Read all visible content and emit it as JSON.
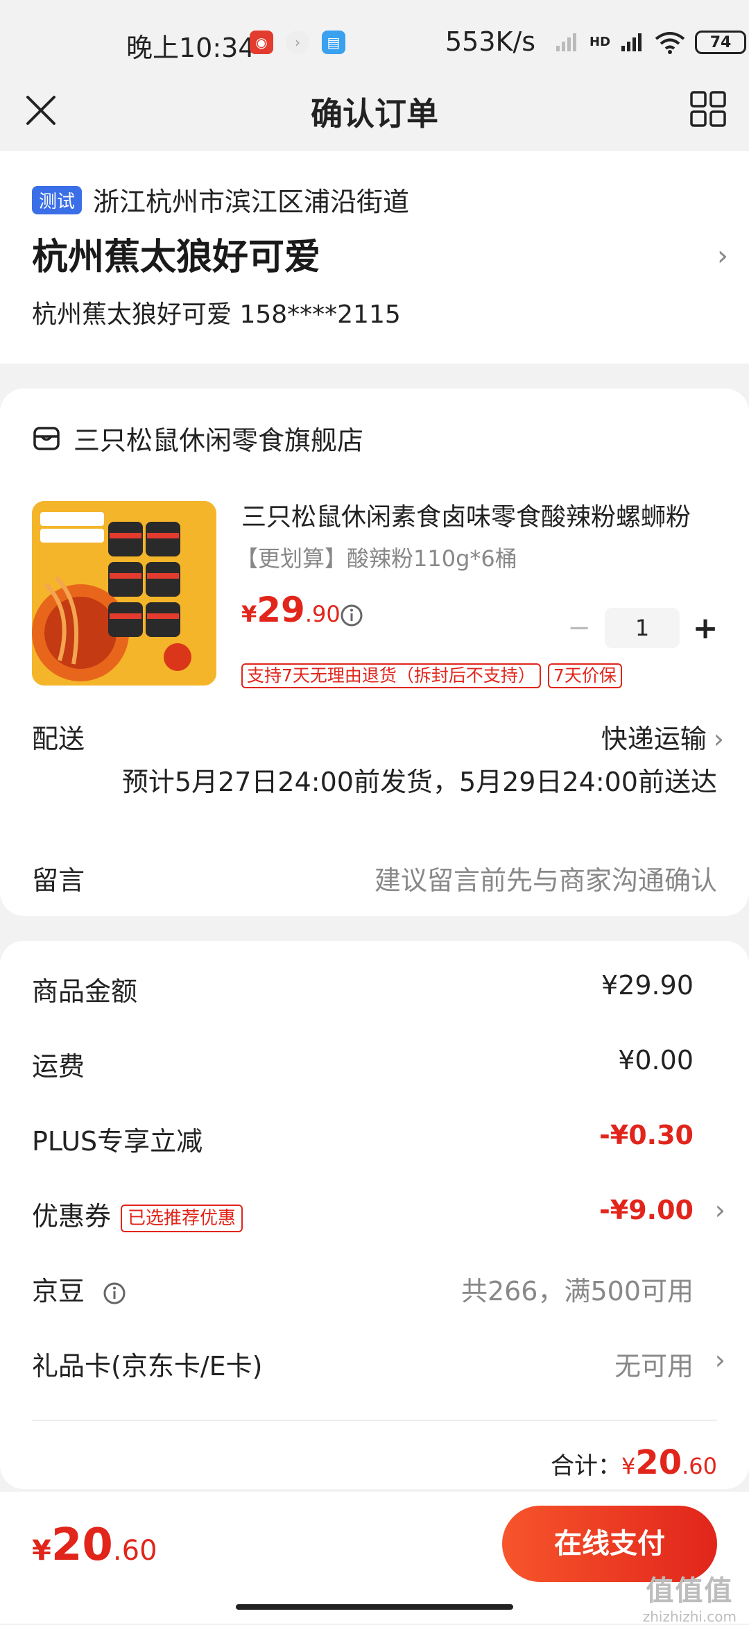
{
  "status_bar": {
    "time": "晚上10:34",
    "net_speed": "553K/s",
    "hd_label": "HD",
    "battery": "74"
  },
  "nav": {
    "title": "确认订单"
  },
  "address": {
    "tag": "测试",
    "region": "浙江杭州市滨江区浦沿街道",
    "title": "杭州蕉太狼好可爱",
    "person": "杭州蕉太狼好可爱  158****2115",
    "chevron": "›"
  },
  "shop": {
    "name": "三只松鼠休闲零食旗舰店"
  },
  "product": {
    "name": "三只松鼠休闲素食卤味零食酸辣粉螺蛳粉",
    "spec": "【更划算】酸辣粉110g*6桶",
    "price_symbol": "¥",
    "price_int": "29",
    "price_dec": ".90",
    "quantity": "1",
    "minus": "−",
    "plus": "+",
    "badges": [
      "支持7天无理由退货（拆封后不支持）",
      "7天价保"
    ]
  },
  "delivery": {
    "label": "配送",
    "method": "快递运输",
    "chevron": "›",
    "eta": "预计5月27日24:00前发货，5月29日24:00前送达"
  },
  "note": {
    "label": "留言",
    "placeholder": "建议留言前先与商家沟通确认"
  },
  "summary": {
    "rows": [
      {
        "label": "商品金额",
        "value": "¥29.90"
      },
      {
        "label": "运费",
        "value": "¥0.00"
      },
      {
        "label": "PLUS专享立减",
        "value": "-¥0.30"
      },
      {
        "label": "优惠券",
        "tag": "已选推荐优惠",
        "value": "-¥9.00"
      },
      {
        "label": "京豆",
        "value": "共266，满500可用"
      },
      {
        "label": "礼品卡(京东卡/E卡)",
        "value": "无可用"
      }
    ],
    "total_label": "合计：",
    "total_symbol": "¥",
    "total_int": "20",
    "total_dec": ".60"
  },
  "bottom_bar": {
    "price_symbol": "¥",
    "price_int": "20",
    "price_dec": ".60",
    "pay_label": "在线支付"
  },
  "watermark": {
    "main": "值值值",
    "sub": "zhizhizhi.com"
  },
  "colors": {
    "accent_red": "#e1251b",
    "tag_blue": "#3b6fe8",
    "background": "#f2f2f2"
  }
}
